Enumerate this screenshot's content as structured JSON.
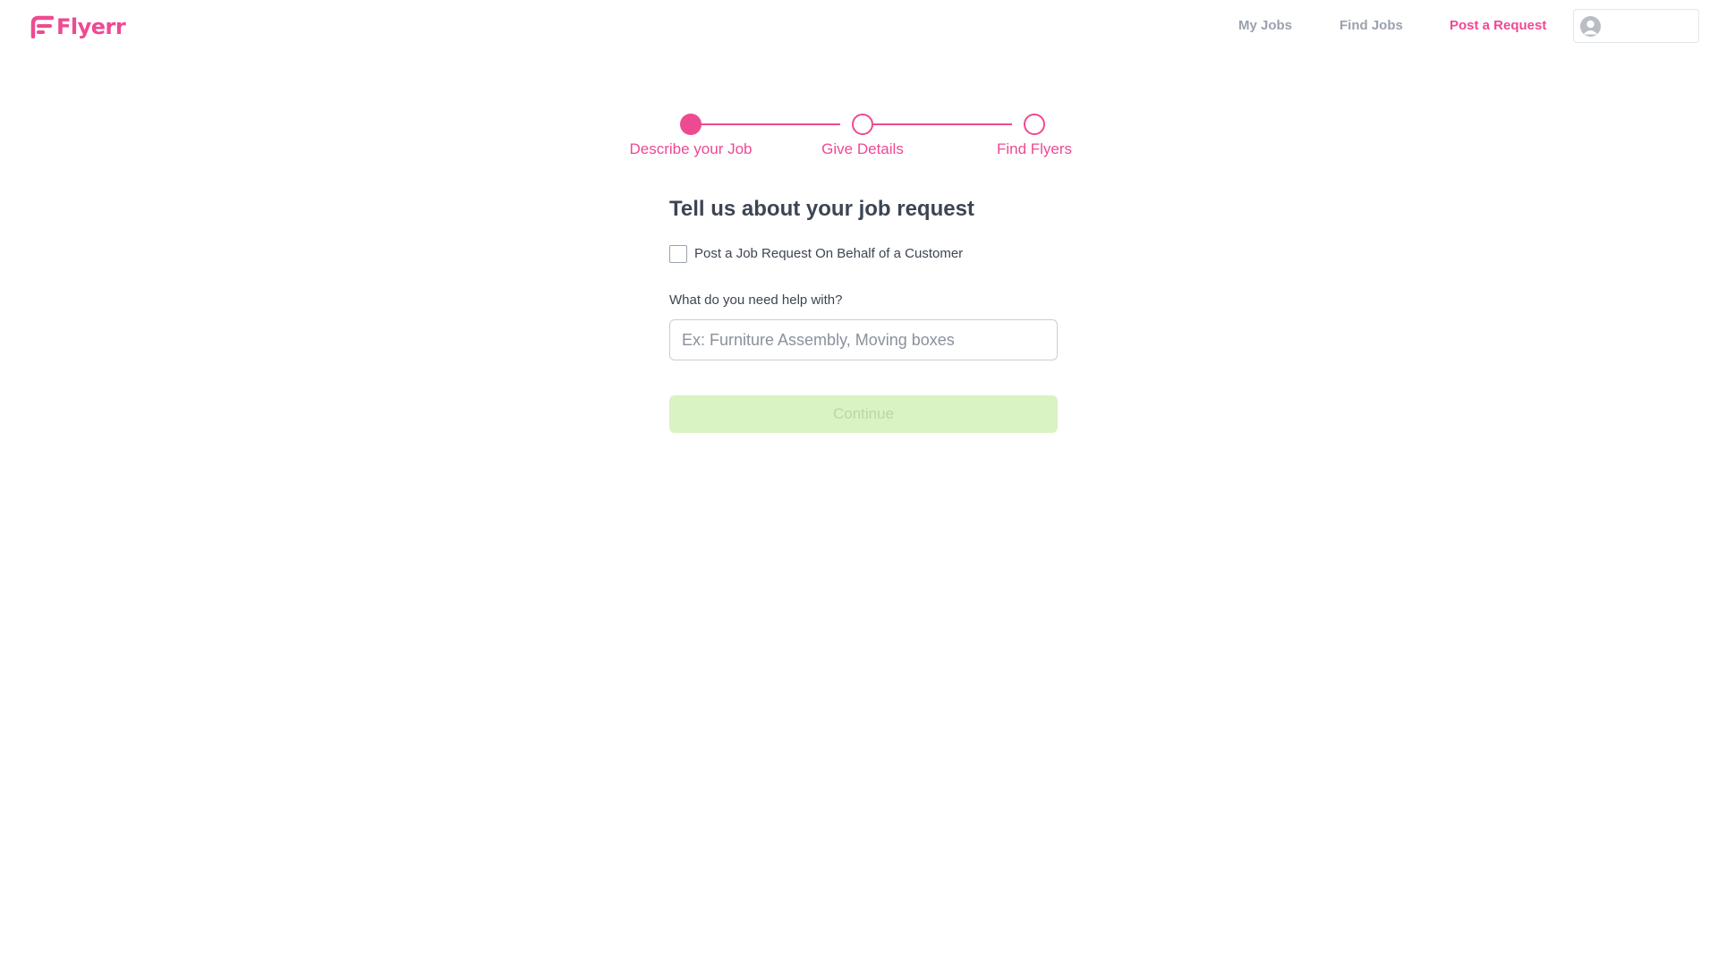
{
  "brand": {
    "name": "Flyerr",
    "color": "#ee4a92"
  },
  "nav": {
    "items": [
      {
        "label": "My Jobs",
        "active": false
      },
      {
        "label": "Find Jobs",
        "active": false
      },
      {
        "label": "Post a Request",
        "active": true
      }
    ],
    "avatar_icon": "user-avatar-icon"
  },
  "stepper": {
    "steps": [
      {
        "label": "Describe your Job",
        "state": "current"
      },
      {
        "label": "Give Details",
        "state": "upcoming"
      },
      {
        "label": "Find Flyers",
        "state": "upcoming"
      }
    ],
    "color": "#ee4a92"
  },
  "form": {
    "title": "Tell us about your job request",
    "behalf_checkbox": {
      "label": "Post a Job Request On Behalf of a Customer",
      "checked": false
    },
    "help_field": {
      "label": "What do you need help with?",
      "value": "",
      "placeholder": "Ex: Furniture Assembly, Moving boxes"
    },
    "continue_label": "Continue",
    "continue_enabled": false,
    "continue_color": "#d9f3c2"
  }
}
